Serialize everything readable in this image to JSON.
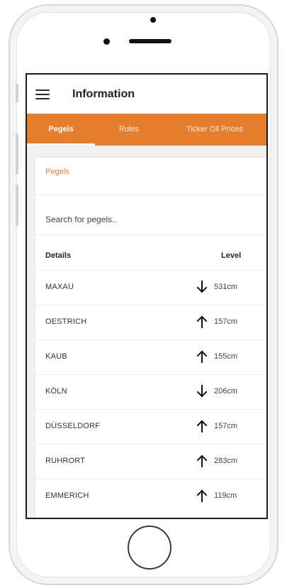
{
  "app": {
    "title": "Information",
    "accent_color": "#e67e2e"
  },
  "tabs": [
    {
      "label": "Pegels",
      "active": true
    },
    {
      "label": "Rules",
      "active": false
    },
    {
      "label": "Ticker Oil Prices",
      "active": false
    }
  ],
  "card": {
    "title": "Pegels",
    "search": {
      "placeholder": "Search for pegels..",
      "value": ""
    },
    "columns": {
      "details": "Details",
      "level": "Level"
    },
    "rows": [
      {
        "name": "MAXAU",
        "trend": "down",
        "icon": "arrow-down-icon",
        "level": "531cm"
      },
      {
        "name": "OESTRICH",
        "trend": "up",
        "icon": "arrow-up-icon",
        "level": "157cm"
      },
      {
        "name": "KAUB",
        "trend": "up",
        "icon": "arrow-up-icon",
        "level": "155cm"
      },
      {
        "name": "KÖLN",
        "trend": "down",
        "icon": "arrow-down-icon",
        "level": "206cm"
      },
      {
        "name": "DÜSSELDORF",
        "trend": "up",
        "icon": "arrow-up-icon",
        "level": "157cm"
      },
      {
        "name": "RUHRORT",
        "trend": "up",
        "icon": "arrow-up-icon",
        "level": "283cm"
      },
      {
        "name": "EMMERICH",
        "trend": "up",
        "icon": "arrow-up-icon",
        "level": "119cm"
      }
    ]
  }
}
